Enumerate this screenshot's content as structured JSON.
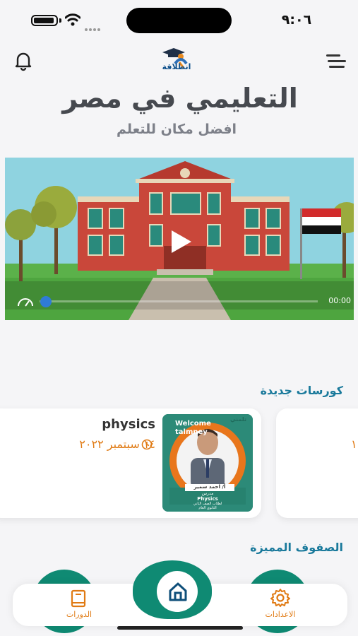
{
  "status_bar": {
    "time": "٩:٠٦"
  },
  "header": {
    "logo_text": "انطلاقة",
    "title": "التعليمي في مصر",
    "subtitle": "افضل مكان للتعلم"
  },
  "video": {
    "time": "00:00",
    "progress": 0
  },
  "new_courses": {
    "title": "كورسات جديدة",
    "items": [
      {
        "name": "physics",
        "date": "١٤ سبتمبر ٢٠٢٢",
        "thumbnail": {
          "corner_text": "تلمني",
          "welcome": "Welcome",
          "brand": "talmney",
          "teacher": "أ/ احمد سمير",
          "role": "مدرس",
          "subject": "Physics",
          "line1": "لطلاب الصف الثاني",
          "line2": "الثانوي العام"
        }
      },
      {
        "date": "١"
      }
    ]
  },
  "featured": {
    "title": "الصفوف المميزة"
  },
  "bottom_nav": {
    "courses": "الدورات",
    "settings": "الاعدادات"
  },
  "colors": {
    "accent_teal": "#0f8a73",
    "accent_orange": "#e07a13",
    "section_blue": "#19799b"
  }
}
